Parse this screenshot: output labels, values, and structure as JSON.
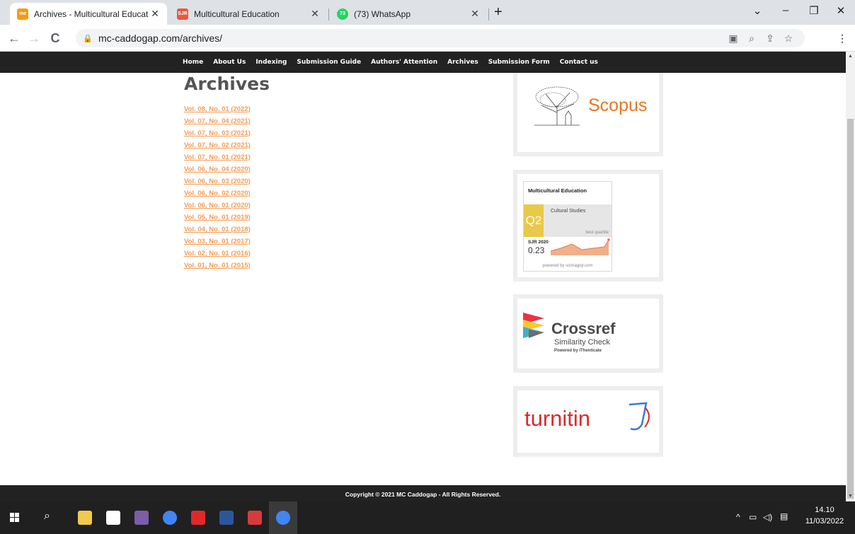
{
  "browser": {
    "tabs": [
      {
        "favicon": "me",
        "title": "Archives - Multicultural Educatio",
        "active": true,
        "favicon_color": "#f39c12"
      },
      {
        "favicon": "SJR",
        "title": "Multicultural Education",
        "active": false,
        "favicon_color": "#e8593a"
      },
      {
        "favicon": "73",
        "title": "(73) WhatsApp",
        "active": false,
        "favicon_color": "#25d366"
      }
    ],
    "new_tab_symbol": "+",
    "url": "mc-caddogap.com/archives/"
  },
  "site_nav": {
    "items": [
      "Home",
      "About Us",
      "Indexing",
      "Submission Guide",
      "Authors' Attention",
      "Archives",
      "Submission Form",
      "Contact us"
    ]
  },
  "main": {
    "heading": "Archives",
    "volumes": [
      "Vol. 08, No. 01 (2022)",
      "Vol. 07, No. 04 (2021)",
      "Vol. 07, No. 03 (2021)",
      "Vol. 07, No. 02 (2021)",
      "Vol. 07, No. 01 (2021)",
      "Vol. 06, No. 04 (2020)",
      "Vol. 06, No. 03 (2020)",
      "Vol. 06, No. 02 (2020)",
      "Vol. 06, No. 01 (2020)",
      "Vol. 05, No. 01 (2019)",
      "Vol. 04, No. 01 (2018)",
      "Vol. 03, No. 01 (2017)",
      "Vol. 02, No. 01 (2016)",
      "Vol. 01, No. 01 (2015)"
    ]
  },
  "sidebar": {
    "scopus_label": "Scopus",
    "sjr": {
      "journal": "Multicultural Education",
      "quartile": "Q2",
      "category": "Cultural Studies",
      "quartile_note": "best quartile",
      "year_label": "SJR 2020",
      "value": "0.23",
      "powered": "powered by scimagojr.com"
    },
    "crossref": {
      "title": "Crossref",
      "subtitle": "Similarity Check",
      "powered": "Powered by iThenticate"
    },
    "turnitin_label": "turnitin"
  },
  "footer": {
    "copyright": "Copyright © 2021 MC Caddogap - All Rights Reserved."
  },
  "taskbar": {
    "time": "14.10",
    "date": "11/03/2022"
  },
  "colors": {
    "link": "#f39c55",
    "nav_bg": "#222222",
    "scopus_orange": "#e87722",
    "sjr_yellow": "#e8c94a",
    "turnitin_red": "#d92b2b"
  }
}
